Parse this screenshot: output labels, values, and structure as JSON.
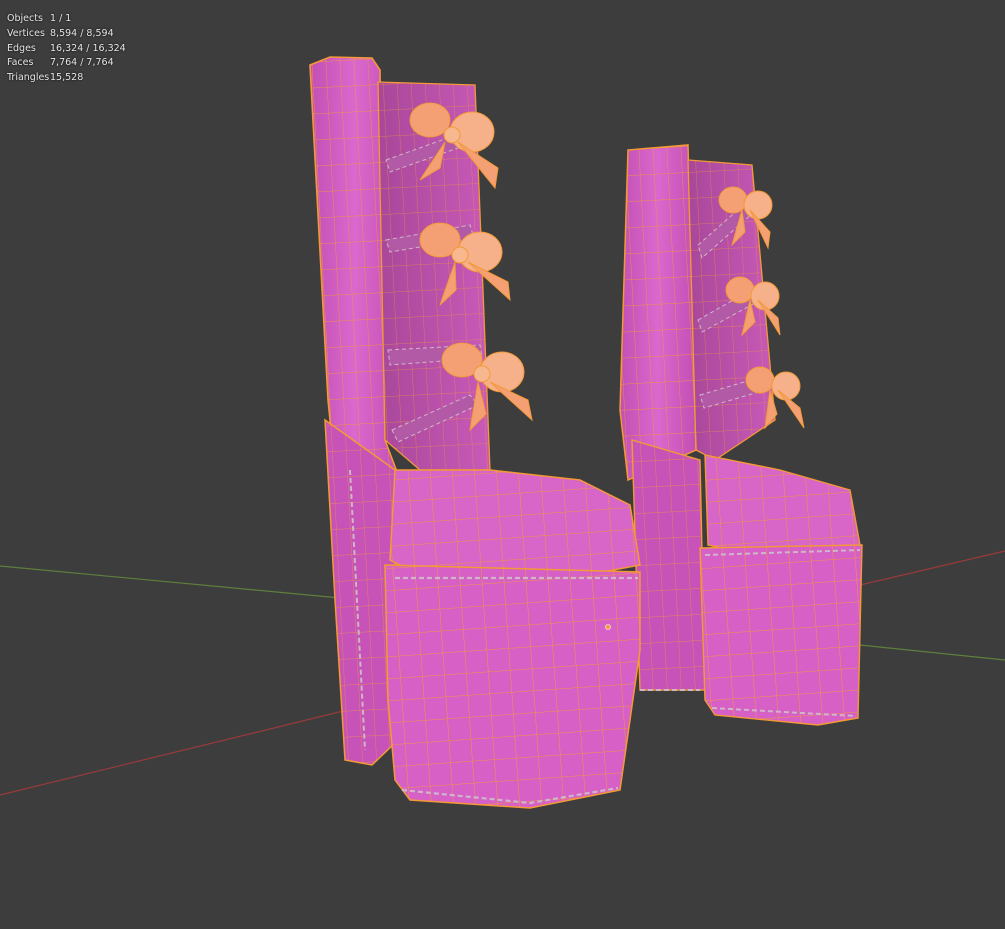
{
  "stats": [
    {
      "label": "Objects",
      "value": "1 / 1"
    },
    {
      "label": "Vertices",
      "value": "8,594 / 8,594"
    },
    {
      "label": "Edges",
      "value": "16,324 / 16,324"
    },
    {
      "label": "Faces",
      "value": "7,764 / 7,764"
    },
    {
      "label": "Triangles",
      "value": "15,528"
    }
  ],
  "colors": {
    "background": "#3d3d3d",
    "mesh_fill": "#d45ec4",
    "wire": "#f39a36",
    "bow": "#f4a074",
    "axis_x": "#9b3a3a",
    "axis_y": "#5f7f3c"
  }
}
